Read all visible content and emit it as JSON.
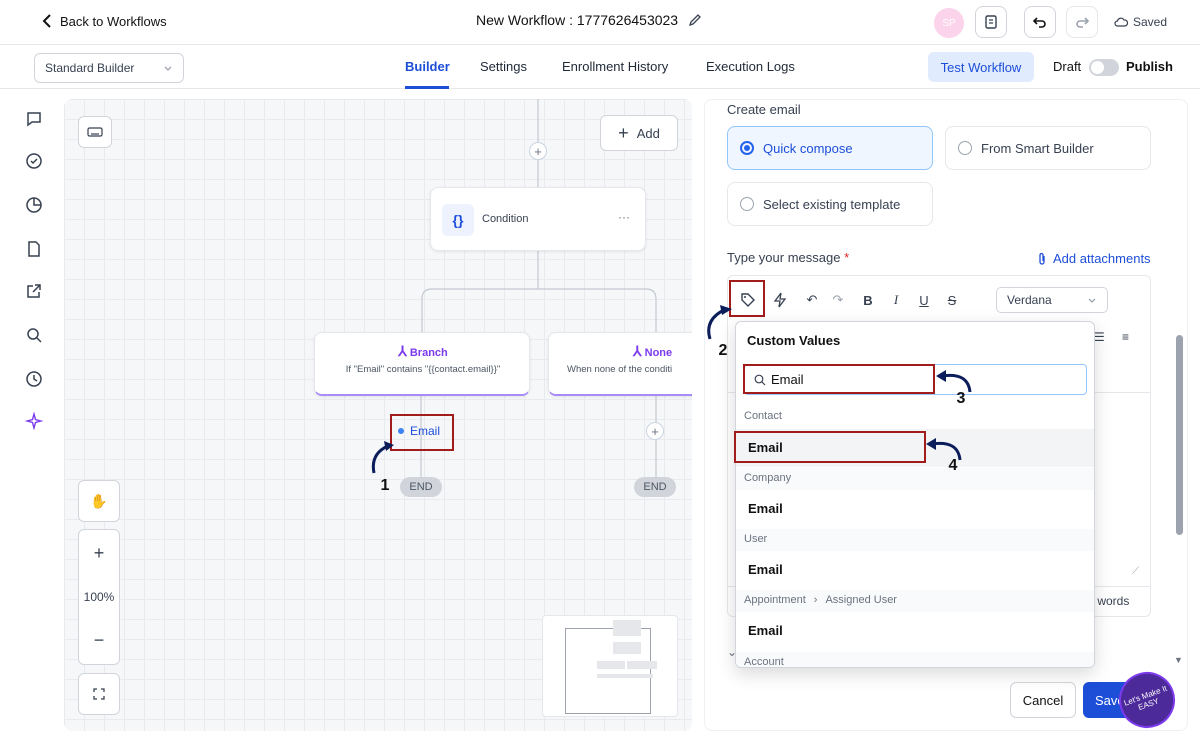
{
  "header": {
    "back_label": "Back to Workflows",
    "workflow_title": "New Workflow : 1777626453023",
    "avatar_initials": "SP",
    "saved_label": "Saved"
  },
  "subheader": {
    "builder_mode": "Standard Builder",
    "tabs": [
      {
        "label": "Builder",
        "active": true
      },
      {
        "label": "Settings"
      },
      {
        "label": "Enrollment History"
      },
      {
        "label": "Execution Logs"
      }
    ],
    "test_workflow_label": "Test Workflow",
    "draft_label": "Draft",
    "publish_label": "Publish"
  },
  "canvas": {
    "add_label": "Add",
    "condition_label": "Condition",
    "branch": {
      "title": "Branch",
      "desc": "If \"Email\" contains \"{{contact.email}}\""
    },
    "none": {
      "title": "None",
      "desc": "When none of the conditi"
    },
    "email_node_label": "Email",
    "end_label": "END",
    "zoom_level": "100%"
  },
  "panel": {
    "create_email_label": "Create email",
    "options": {
      "quick_compose": "Quick compose",
      "smart_builder": "From Smart Builder",
      "existing_template": "Select existing template"
    },
    "message_label": "Type your message",
    "required_mark": "*",
    "add_attachments_label": "Add attachments",
    "font": "Verdana",
    "word_count_suffix": ") words",
    "cancel_label": "Cancel",
    "save_label": "Save"
  },
  "dropdown": {
    "title": "Custom Values",
    "search_value": "Email",
    "sections": [
      {
        "label": "Contact",
        "item": "Email"
      },
      {
        "label": "Company",
        "item": "Email"
      },
      {
        "label": "User",
        "item": "Email"
      },
      {
        "label": "Appointment",
        "sublabel": "Assigned User",
        "item": "Email"
      },
      {
        "label": "Account"
      }
    ]
  },
  "annotations": {
    "step1": "1",
    "step2": "2",
    "step3": "3",
    "step4": "4"
  },
  "logo_text": "Let's Make It EASY",
  "colors": {
    "accent": "#2563eb",
    "annotation": "#a31c1c",
    "branch_purple": "#7c3aed"
  }
}
